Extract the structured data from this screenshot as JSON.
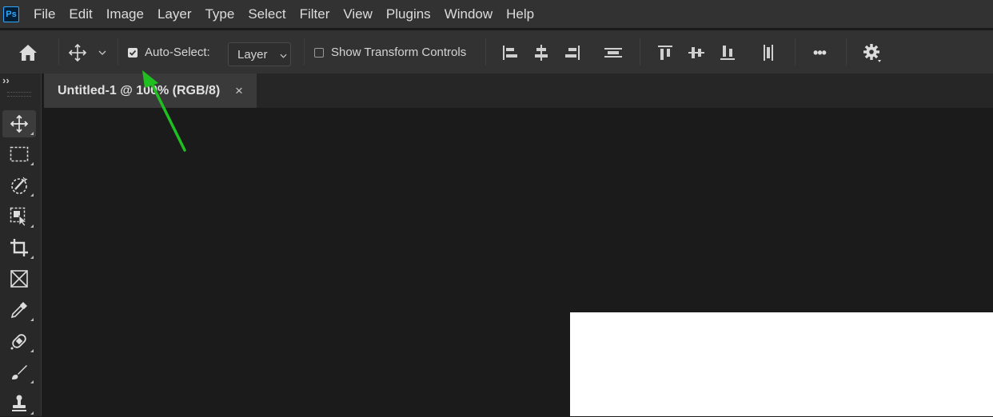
{
  "app": {
    "logo_text": "Ps"
  },
  "menu": [
    "File",
    "Edit",
    "Image",
    "Layer",
    "Type",
    "Select",
    "Filter",
    "View",
    "Plugins",
    "Window",
    "Help"
  ],
  "options_bar": {
    "auto_select_label": "Auto-Select:",
    "auto_select_checked": true,
    "auto_select_target": "Layer",
    "show_transform_controls_label": "Show Transform Controls",
    "show_transform_controls_checked": false,
    "more_label": "•••"
  },
  "tools_panel": {
    "collapse_label": "››",
    "tools": [
      "move-tool",
      "rectangular-marquee-tool",
      "object-selection-tool",
      "artboard-select-tool",
      "crop-tool",
      "frame-tool",
      "eyedropper-tool",
      "spot-healing-brush-tool",
      "brush-tool",
      "clone-stamp-tool"
    ],
    "active_tool": "move-tool"
  },
  "document": {
    "tab_title": "Untitled-1 @ 100% (RGB/8)",
    "close_label": "×",
    "canvas_color": "#ffffff"
  },
  "annotation": {
    "arrow_color": "#1fbf1f"
  },
  "colors": {
    "menubar": "#323232",
    "workspace": "#1b1b1b",
    "ps_blue": "#31a8ff",
    "ps_dark": "#001e36"
  }
}
